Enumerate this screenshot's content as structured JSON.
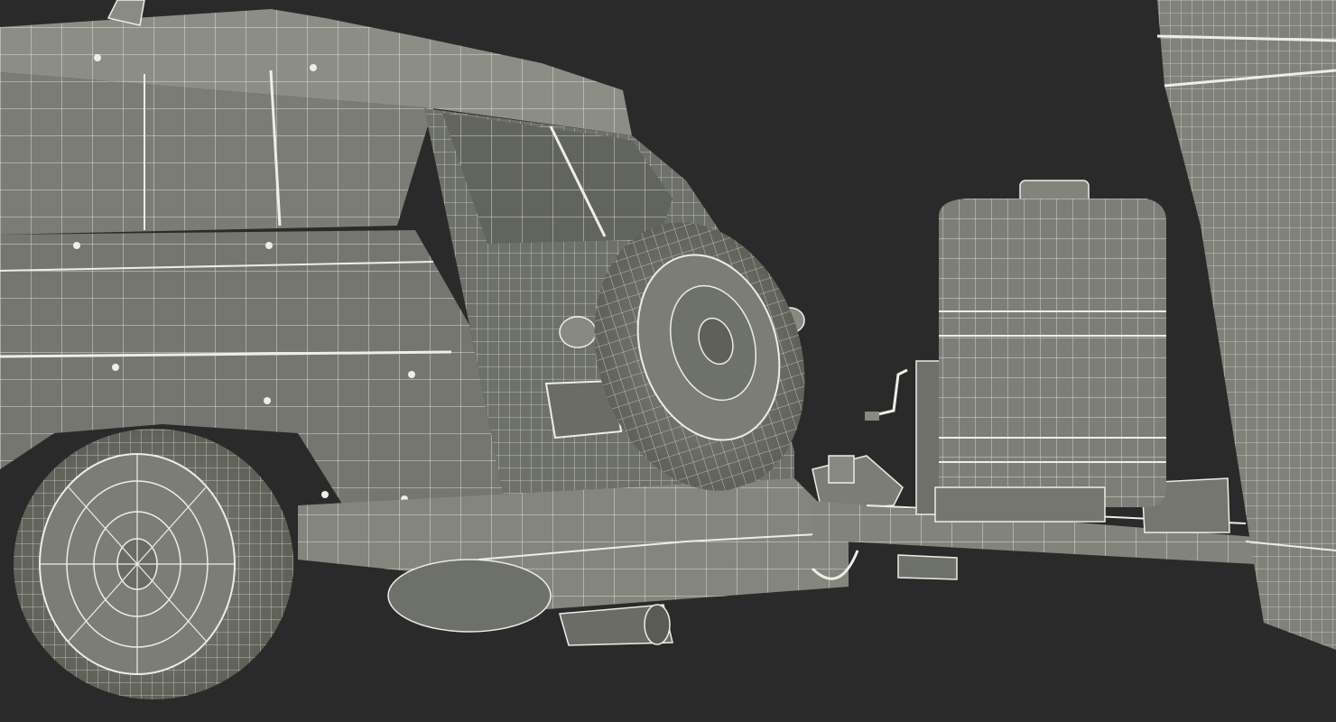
{
  "scene": {
    "kind": "3d-wireframe-render",
    "background_color": "#2a2a2a",
    "shade_color": "#7d7f77",
    "shade_dark": "#5e6059",
    "shade_light": "#9a9c93",
    "wire_color": "#eeeee6",
    "objects": [
      "station-wagon-rear",
      "spare-tire",
      "rear-wheel",
      "tow-hitch",
      "trailer-frame",
      "water-tank",
      "tongue-jack",
      "trailer-body"
    ]
  }
}
